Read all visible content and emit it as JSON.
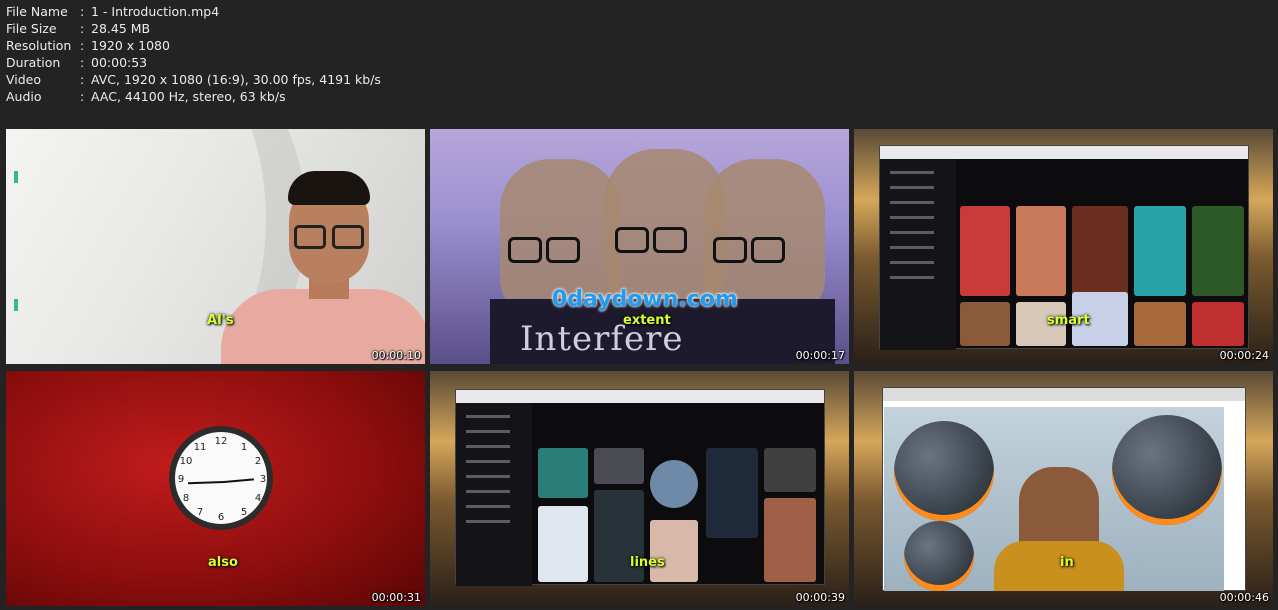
{
  "meta": [
    {
      "key": "File Name",
      "value": "1 - Introduction.mp4"
    },
    {
      "key": "File Size",
      "value": "28.45 MB"
    },
    {
      "key": "Resolution",
      "value": "1920 x 1080"
    },
    {
      "key": "Duration",
      "value": "00:00:53"
    },
    {
      "key": "Video",
      "value": "AVC, 1920 x 1080 (16:9), 30.00 fps, 4191 kb/s"
    },
    {
      "key": "Audio",
      "value": "AAC, 44100 Hz, stereo, 63 kb/s"
    }
  ],
  "separator": ":",
  "thumbnails": [
    {
      "timestamp": "00:00:10",
      "caption": "AI's"
    },
    {
      "timestamp": "00:00:17",
      "caption": "extent",
      "brand": "0daydown.com",
      "overlay_text": "Interfere"
    },
    {
      "timestamp": "00:00:24",
      "caption": "smart"
    },
    {
      "timestamp": "00:00:31",
      "caption": "also"
    },
    {
      "timestamp": "00:00:39",
      "caption": "lines"
    },
    {
      "timestamp": "00:00:46",
      "caption": "in"
    }
  ]
}
